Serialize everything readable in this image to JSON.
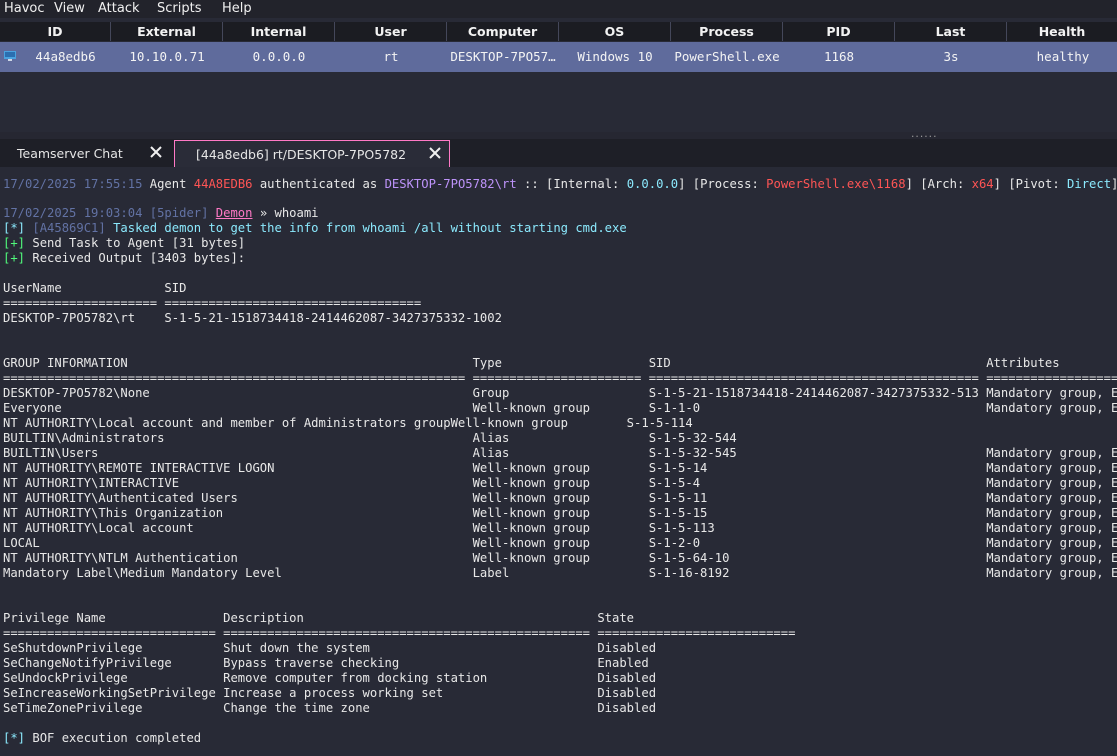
{
  "menu": [
    "Havoc",
    "View",
    "Attack",
    "Scripts",
    "Help"
  ],
  "sessions": {
    "columns": [
      "ID",
      "External",
      "Internal",
      "User",
      "Computer",
      "OS",
      "Process",
      "PID",
      "Last",
      "Health"
    ],
    "row": {
      "os_icon": "windows-icon",
      "id": "44a8edb6",
      "external": "10.10.0.71",
      "internal": "0.0.0.0",
      "user": "rt",
      "computer": "DESKTOP-7PO57…",
      "os": "Windows 10",
      "process": "PowerShell.exe",
      "pid": "1168",
      "last": "3s",
      "health": "healthy"
    },
    "splitter_grip": "......"
  },
  "tabs": [
    {
      "label": "Teamserver Chat"
    },
    {
      "label": "[44a8edb6] rt/DESKTOP-7PO5782"
    }
  ],
  "console": {
    "auth": {
      "time": "17/02/2025 17:55:15",
      "agent_word": " Agent ",
      "agent_id": "44A8EDB6",
      "mid": " authenticated as ",
      "user": "DESKTOP-7PO5782\\rt",
      "s1": " :: [Internal: ",
      "internal": "0.0.0.0",
      "s2": "] [Process: ",
      "process": "PowerShell.exe\\1168",
      "s3": "] [Arch: ",
      "arch": "x64",
      "s4": "] [Pivot: ",
      "pivot": "Direct",
      "s5": "]"
    },
    "cmd": {
      "time": "17/02/2025 19:03:04",
      "operator": " [5pider] ",
      "target": "Demon",
      "arrow": " » ",
      "command": "whoami"
    },
    "task": {
      "prefix": "[*]",
      "id": " [A45869C1]",
      "text": " Tasked demon to get the info from whoami /all without starting cmd.exe"
    },
    "send": {
      "prefix": "[+]",
      "text": " Send Task to Agent [31 bytes]"
    },
    "recv": {
      "prefix": "[+]",
      "text": " Received Output [3403 bytes]:"
    },
    "output": [
      "UserName              SID",
      "===================== ===================================",
      "DESKTOP-7PO5782\\rt    S-1-5-21-1518734418-2414462087-3427375332-1002",
      "GROUP INFORMATION                                               Type                    SID                                           Attributes",
      "=============================================================== ======================= ============================================= ==================================================",
      "DESKTOP-7PO5782\\None                                            Group                   S-1-5-21-1518734418-2414462087-3427375332-513 Mandatory group, Enabled by default, Enabled group",
      "Everyone                                                        Well-known group        S-1-1-0                                       Mandatory group, Enabled by default, Enabled group",
      "NT AUTHORITY\\Local account and member of Administrators groupWell-known group        S-1-5-114",
      "BUILTIN\\Administrators                                          Alias                   S-1-5-32-544",
      "BUILTIN\\Users                                                   Alias                   S-1-5-32-545                                  Mandatory group, Enabled by default, Enabled group",
      "NT AUTHORITY\\REMOTE INTERACTIVE LOGON                           Well-known group        S-1-5-14                                      Mandatory group, Enabled by default, Enabled group",
      "NT AUTHORITY\\INTERACTIVE                                        Well-known group        S-1-5-4                                       Mandatory group, Enabled by default, Enabled group",
      "NT AUTHORITY\\Authenticated Users                                Well-known group        S-1-5-11                                      Mandatory group, Enabled by default, Enabled group",
      "NT AUTHORITY\\This Organization                                  Well-known group        S-1-5-15                                      Mandatory group, Enabled by default, Enabled group",
      "NT AUTHORITY\\Local account                                      Well-known group        S-1-5-113                                     Mandatory group, Enabled by default, Enabled group",
      "LOCAL                                                           Well-known group        S-1-2-0                                       Mandatory group, Enabled by default, Enabled group",
      "NT AUTHORITY\\NTLM Authentication                                Well-known group        S-1-5-64-10                                   Mandatory group, Enabled by default, Enabled group",
      "Mandatory Label\\Medium Mandatory Level                          Label                   S-1-16-8192                                   Mandatory group, Enabled by default, Enabled group",
      "Privilege Name                Description                                        State",
      "============================= ================================================== ===========================",
      "SeShutdownPrivilege           Shut down the system                               Disabled",
      "SeChangeNotifyPrivilege       Bypass traverse checking                           Enabled",
      "SeUndockPrivilege             Remove computer from docking station               Disabled",
      "SeIncreaseWorkingSetPrivilege Increase a process working set                     Disabled",
      "SeTimeZonePrivilege           Change the time zone                               Disabled"
    ],
    "done": {
      "prefix": "[*]",
      "text": " BOF execution completed"
    }
  }
}
